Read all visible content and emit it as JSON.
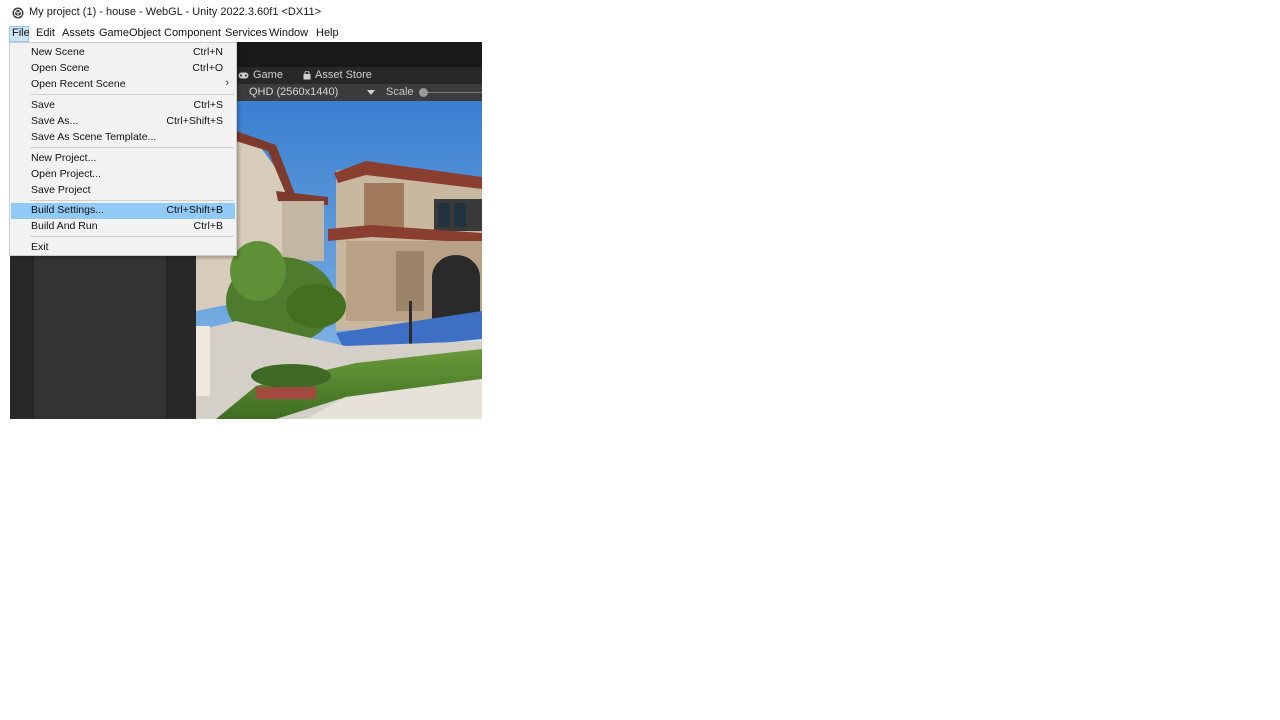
{
  "window": {
    "title": "My project (1) - house - WebGL - Unity 2022.3.60f1 <DX11>"
  },
  "menubar": {
    "items": [
      {
        "label": "File",
        "active": true
      },
      {
        "label": "Edit"
      },
      {
        "label": "Assets"
      },
      {
        "label": "GameObject"
      },
      {
        "label": "Component"
      },
      {
        "label": "Services"
      },
      {
        "label": "Window"
      },
      {
        "label": "Help"
      }
    ]
  },
  "file_menu": {
    "items": [
      {
        "label": "New Scene",
        "shortcut": "Ctrl+N"
      },
      {
        "label": "Open Scene",
        "shortcut": "Ctrl+O"
      },
      {
        "label": "Open Recent Scene",
        "submenu": "›"
      },
      {
        "label": "Save",
        "shortcut": "Ctrl+S"
      },
      {
        "label": "Save As...",
        "shortcut": "Ctrl+Shift+S"
      },
      {
        "label": "Save As Scene Template..."
      },
      {
        "label": "New Project..."
      },
      {
        "label": "Open Project..."
      },
      {
        "label": "Save Project"
      },
      {
        "label": "Build Settings...",
        "shortcut": "Ctrl+Shift+B",
        "highlighted": true
      },
      {
        "label": "Build And Run",
        "shortcut": "Ctrl+B"
      },
      {
        "label": "Exit"
      }
    ]
  },
  "editor": {
    "tabs": [
      {
        "label": "Game",
        "icon": "gamepad-icon"
      },
      {
        "label": "Asset Store",
        "icon": "shopping-bag-icon"
      }
    ],
    "game_toolbar": {
      "resolution": "QHD (2560x1440)",
      "scale_label": "Scale",
      "scale_value": 0.0
    }
  },
  "colors": {
    "menu_highlight": "#91c9f7",
    "menubar_active": "#cce4f7",
    "editor_dark": "#282828",
    "toolbar_gray": "#3c3c3c"
  }
}
